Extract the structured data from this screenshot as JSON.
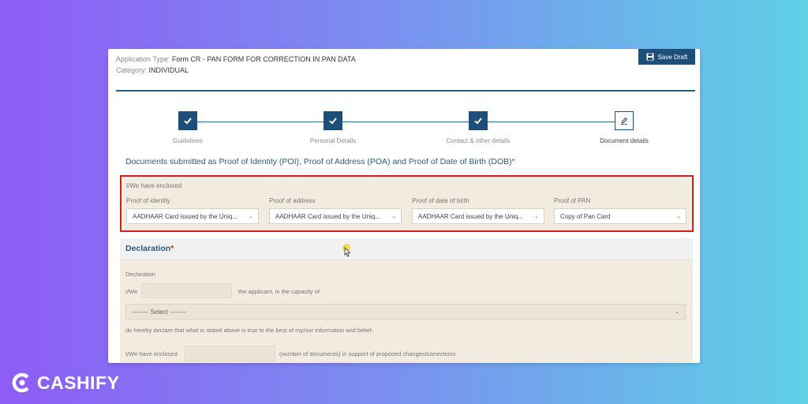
{
  "header": {
    "application_type_label": "Application Type:",
    "application_type_value": "Form CR - PAN FORM FOR CORRECTION IN PAN DATA",
    "category_label": "Category:",
    "category_value": "INDIVIDUAL",
    "save_draft_label": "Save Draft"
  },
  "stepper": {
    "steps": [
      {
        "label": "Guidelines",
        "state": "done"
      },
      {
        "label": "Personal Details",
        "state": "done"
      },
      {
        "label": "Contact & other details",
        "state": "done"
      },
      {
        "label": "Document details",
        "state": "current"
      }
    ]
  },
  "documents": {
    "title": "Documents submitted as Proof of Identity (POI), Proof of Address (POA) and Proof of Date of Birth (DOB)",
    "required_mark": "*",
    "enclosed_label": "I/We have enclosed",
    "proofs": [
      {
        "label": "Proof of identity",
        "value": "AADHAAR Card issued by the Uniq..."
      },
      {
        "label": "Proof of address",
        "value": "AADHAAR Card issued by the Uniq..."
      },
      {
        "label": "Proof of date of birth",
        "value": "AADHAAR Card issued by the Uniq..."
      },
      {
        "label": "Proof of PAN",
        "value": "Copy of Pan Card"
      }
    ]
  },
  "declaration": {
    "title": "Declaration",
    "required_mark": "*",
    "section_label": "Declaration",
    "iwe_label": "I/We",
    "name_value": "",
    "capacity_text": "the applicant, in the capacity of",
    "capacity_select": "-------- Select --------",
    "declare_text": "do hereby declare that what is stated above is true to the best of my/our information and belief.",
    "enclosed_label": "I/We have enclosed",
    "count_value": "",
    "count_suffix": "(number of documents) in support of proposed changes/corrections"
  },
  "brand": {
    "name": "CASHIFY",
    "logo_icon": "cashify-logo-icon"
  },
  "colors": {
    "primary": "#1e4f78",
    "highlight_border": "#d91b22",
    "panel_bg": "#f2ebdf"
  }
}
